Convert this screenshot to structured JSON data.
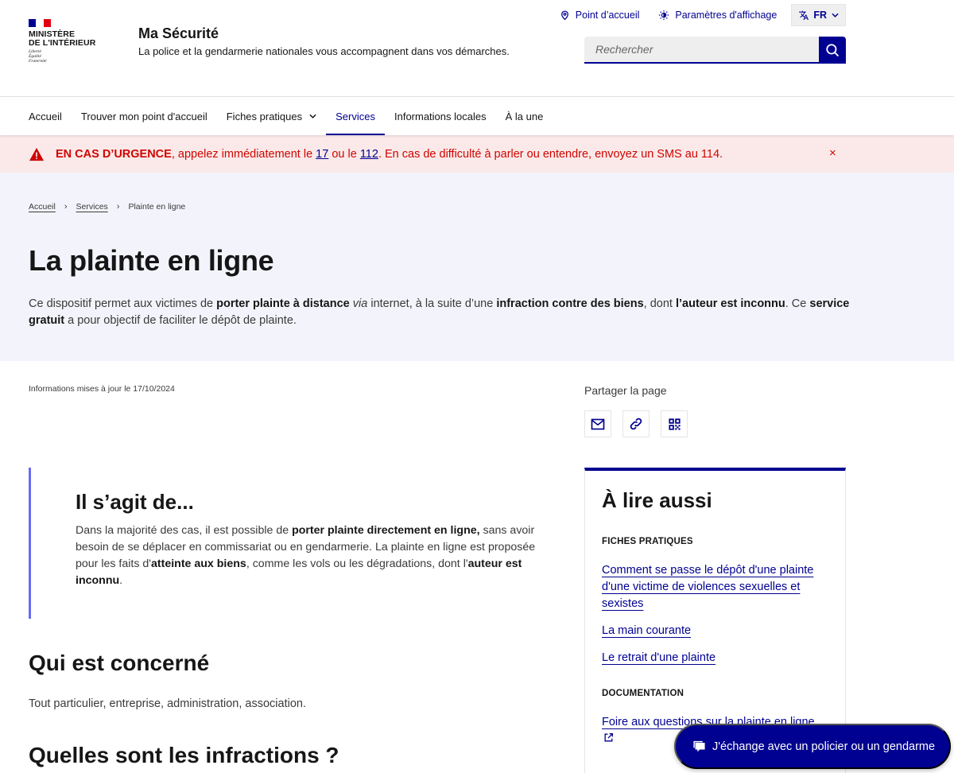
{
  "header": {
    "logo": {
      "ministry_line1": "MINISTÈRE",
      "ministry_line2": "DE L'INTÉRIEUR",
      "motto": [
        "Liberté",
        "Égalité",
        "Fraternité"
      ]
    },
    "site_title": "Ma Sécurité",
    "tagline": "La police et la gendarmerie nationales vous accompagnent dans vos démarches.",
    "tools": {
      "point_accueil": "Point d’accueil",
      "display_settings": "Paramètres d'affichage",
      "language": "FR"
    },
    "search": {
      "placeholder": "Rechercher",
      "value": ""
    }
  },
  "nav": {
    "items": [
      {
        "label": "Accueil",
        "active": false
      },
      {
        "label": "Trouver mon point d'accueil",
        "active": false
      },
      {
        "label": "Fiches pratiques",
        "active": false,
        "has_dropdown": true
      },
      {
        "label": "Services",
        "active": true
      },
      {
        "label": "Informations locales",
        "active": false
      },
      {
        "label": "À la une",
        "active": false
      }
    ]
  },
  "alert": {
    "strong": "EN CAS D’URGENCE",
    "text_1": ", appelez immédiatement le ",
    "number_1": "17",
    "text_2": " ou le ",
    "number_2": "112",
    "text_3": ". En cas de difficulté à parler ou entendre, envoyez un SMS au 114.",
    "close_label": "×"
  },
  "breadcrumb": {
    "items": [
      "Accueil",
      "Services"
    ],
    "current": "Plainte en ligne"
  },
  "page": {
    "title": "La plainte en ligne",
    "intro": {
      "p1": "Ce dispositif permet aux victimes de ",
      "b1": "porter plainte à distance",
      "p2": " ",
      "i1": "via",
      "p3": " internet, à la suite d’une ",
      "b2": "infraction contre des biens",
      "p4": ", dont ",
      "b3": "l’auteur est inconnu",
      "p5": ". Ce ",
      "b4": "service gratuit",
      "p6": " a pour objectif de faciliter le dépôt de plainte."
    },
    "updated": "Informations mises à jour le 17/10/2024"
  },
  "callout": {
    "title": "Il s’agit de...",
    "p1": "Dans la majorité des cas, il est possible de ",
    "b1": "porter plainte directement en ligne,",
    "p2": " sans avoir besoin de se déplacer en commissariat ou en gendarmerie. La plainte en ligne est proposée pour les faits d'",
    "b2": "atteinte aux biens",
    "p3": ", comme les vols ou les dégradations, dont l'",
    "b3": "auteur est inconnu",
    "p4": "."
  },
  "sections": [
    {
      "title": "Qui est concerné",
      "text": "Tout particulier, entreprise, administration, association."
    },
    {
      "title": "Quelles sont les infractions ?"
    }
  ],
  "share": {
    "title": "Partager la page",
    "buttons": [
      {
        "icon": "mail-icon",
        "label": "Partager par e-mail"
      },
      {
        "icon": "link-icon",
        "label": "Copier le lien"
      },
      {
        "icon": "qr-code-icon",
        "label": "QR code"
      }
    ]
  },
  "aside": {
    "title": "À lire aussi",
    "groups": [
      {
        "category": "FICHES PRATIQUES",
        "links": [
          "Comment se passe le dépôt d'une plainte d'une victime de violences sexuelles et sexistes",
          "La main courante",
          "Le retrait d'une plainte"
        ]
      },
      {
        "category": "DOCUMENTATION",
        "links": [
          "Foire aux questions sur la plainte en ligne"
        ]
      }
    ]
  },
  "chat": {
    "label": "J'échange avec un policier ou un gendarme"
  },
  "colors": {
    "primary": "#000091",
    "alert_bg": "#fbe9e9",
    "alert_text": "#ce0500",
    "hero_bg": "#f3f4fb",
    "callout_border": "#6a6af4"
  }
}
